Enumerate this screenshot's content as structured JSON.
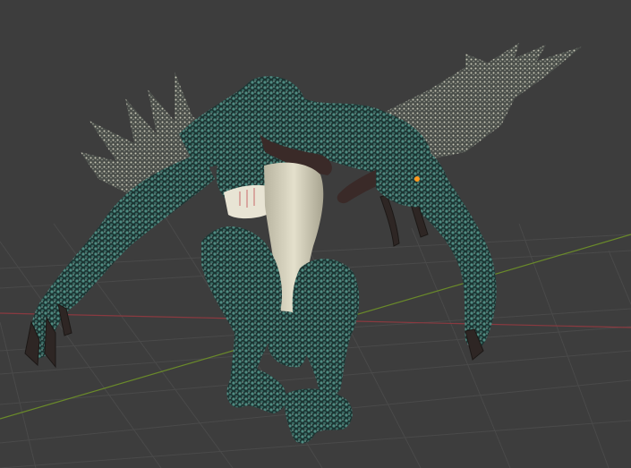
{
  "viewport": {
    "background_color": "#3d3d3d",
    "grid_color": "#4a4a4a",
    "x_axis_color": "#8a3a40",
    "y_axis_color": "#6a8a2a",
    "object": {
      "body_color": "#1f3a38",
      "scale_highlight_color": "#5a9a8e",
      "spike_color": "#9a9a8a",
      "horn_color": "#3a2a28",
      "chest_color": "#d8d4c0",
      "eye_color": "#ff9a20"
    }
  }
}
